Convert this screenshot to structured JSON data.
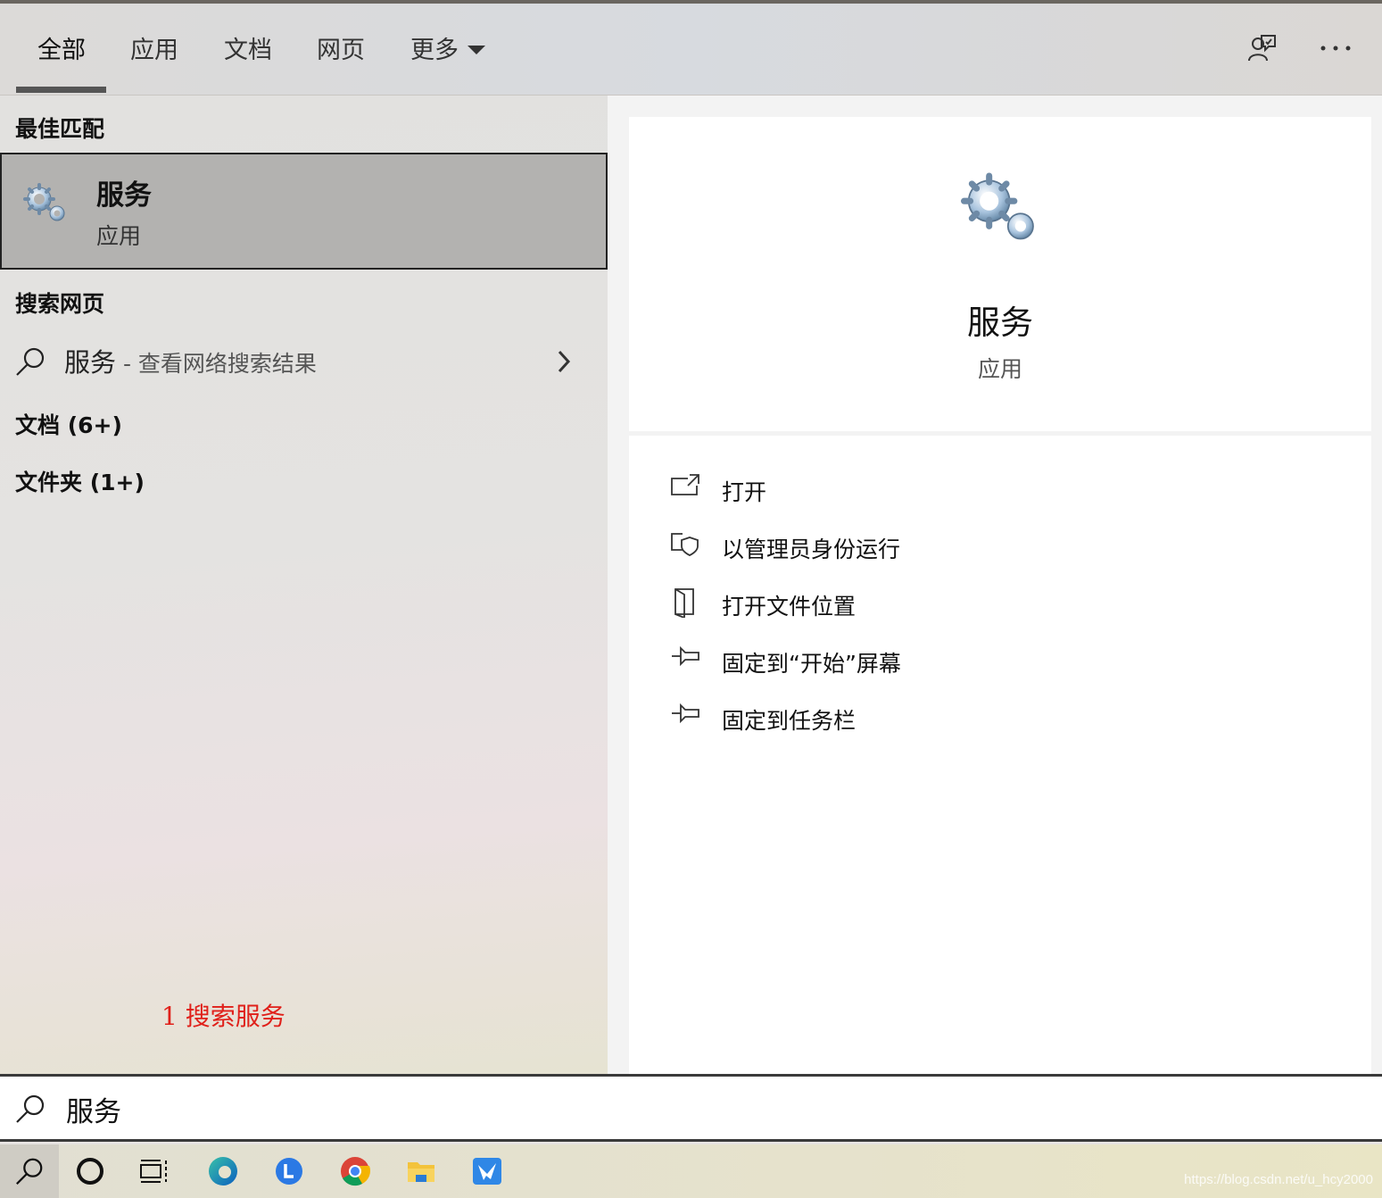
{
  "tabs": [
    {
      "label": "全部",
      "active": true
    },
    {
      "label": "应用"
    },
    {
      "label": "文档"
    },
    {
      "label": "网页"
    },
    {
      "label": "更多"
    }
  ],
  "toolbar": {
    "feedback_icon": "feedback-icon",
    "more_icon": "ellipsis-icon"
  },
  "sections": {
    "best_match": "最佳匹配",
    "search_web": "搜索网页",
    "documents": "文档 (6+)",
    "folders": "文件夹 (1+)"
  },
  "best_match": {
    "title": "服务",
    "subtitle": "应用",
    "icon": "gears-icon"
  },
  "web_search": {
    "query": "服务",
    "hint": " - 查看网络搜索结果"
  },
  "preview": {
    "name": "服务",
    "kind": "应用"
  },
  "actions": [
    {
      "label": "打开",
      "icon": "open-icon"
    },
    {
      "label": "以管理员身份运行",
      "icon": "shield-icon"
    },
    {
      "label": "打开文件位置",
      "icon": "folder-icon"
    },
    {
      "label": "固定到“开始”屏幕",
      "icon": "pin-icon"
    },
    {
      "label": "固定到任务栏",
      "icon": "pin-icon"
    }
  ],
  "annotation": "1 搜索服务",
  "search": {
    "value": "服务"
  },
  "taskbar": [
    "search-icon",
    "cortana-icon",
    "task-view-icon",
    "edge-icon",
    "app-l-icon",
    "chrome-icon",
    "file-explorer-icon",
    "app-bird-icon"
  ],
  "watermark": "https://blog.csdn.net/u_hcy2000",
  "colors": {
    "accent_underline": "#555555",
    "annotation": "#e0201a",
    "selected_bg": "#b3b2b0"
  }
}
